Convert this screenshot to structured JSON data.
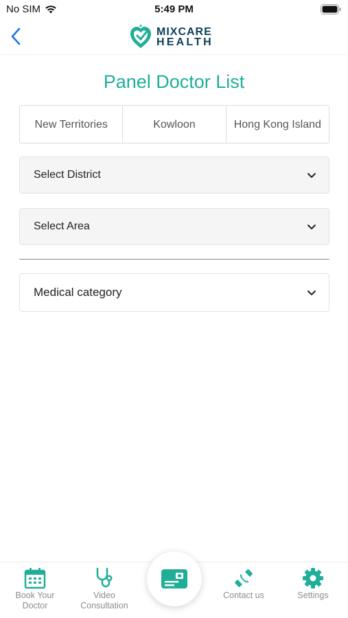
{
  "status_bar": {
    "carrier": "No SIM",
    "time": "5:49 PM"
  },
  "header": {
    "logo_line1": "MIXCARE",
    "logo_line2": "HEALTH"
  },
  "page": {
    "title": "Panel Doctor List"
  },
  "region_tabs": [
    {
      "label": "New Territories"
    },
    {
      "label": "Kowloon"
    },
    {
      "label": "Hong Kong Island"
    }
  ],
  "filters": {
    "district_label": "Select District",
    "area_label": "Select Area",
    "category_label": "Medical category"
  },
  "tab_bar": {
    "items": [
      {
        "label": "Book Your Doctor",
        "icon": "calendar-icon"
      },
      {
        "label": "Video Consultation",
        "icon": "stethoscope-icon"
      },
      {
        "label": "",
        "icon": "member-card-icon"
      },
      {
        "label": "Contact us",
        "icon": "phone-icon"
      },
      {
        "label": "Settings",
        "icon": "gear-icon"
      }
    ]
  },
  "colors": {
    "accent": "#1fae97",
    "brand_dark": "#0c3d59",
    "back_arrow": "#1a73e8",
    "tab_label": "#8d8d8d"
  }
}
